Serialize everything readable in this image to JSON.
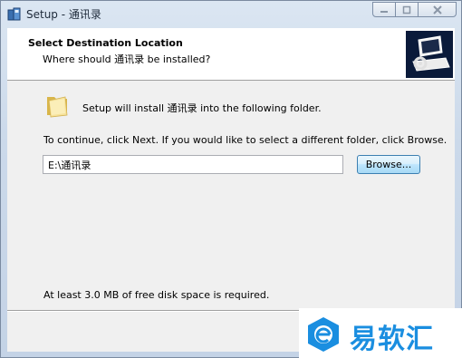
{
  "window": {
    "title": "Setup - 通讯录",
    "controls": {
      "minimize": "minimize",
      "maximize": "maximize",
      "close": "close"
    }
  },
  "header": {
    "title": "Select Destination Location",
    "subtitle": "Where should 通讯录 be installed?"
  },
  "body": {
    "install_text": "Setup will install 通讯录 into the following folder.",
    "instruction_text": "To continue, click Next. If you would like to select a different folder, click Browse.",
    "path_value": "E:\\通讯录",
    "browse_label": "Browse...",
    "space_text": "At least 3.0 MB of free disk space is required."
  },
  "watermark": {
    "text": "易软汇",
    "color": "#1a8ee0"
  }
}
